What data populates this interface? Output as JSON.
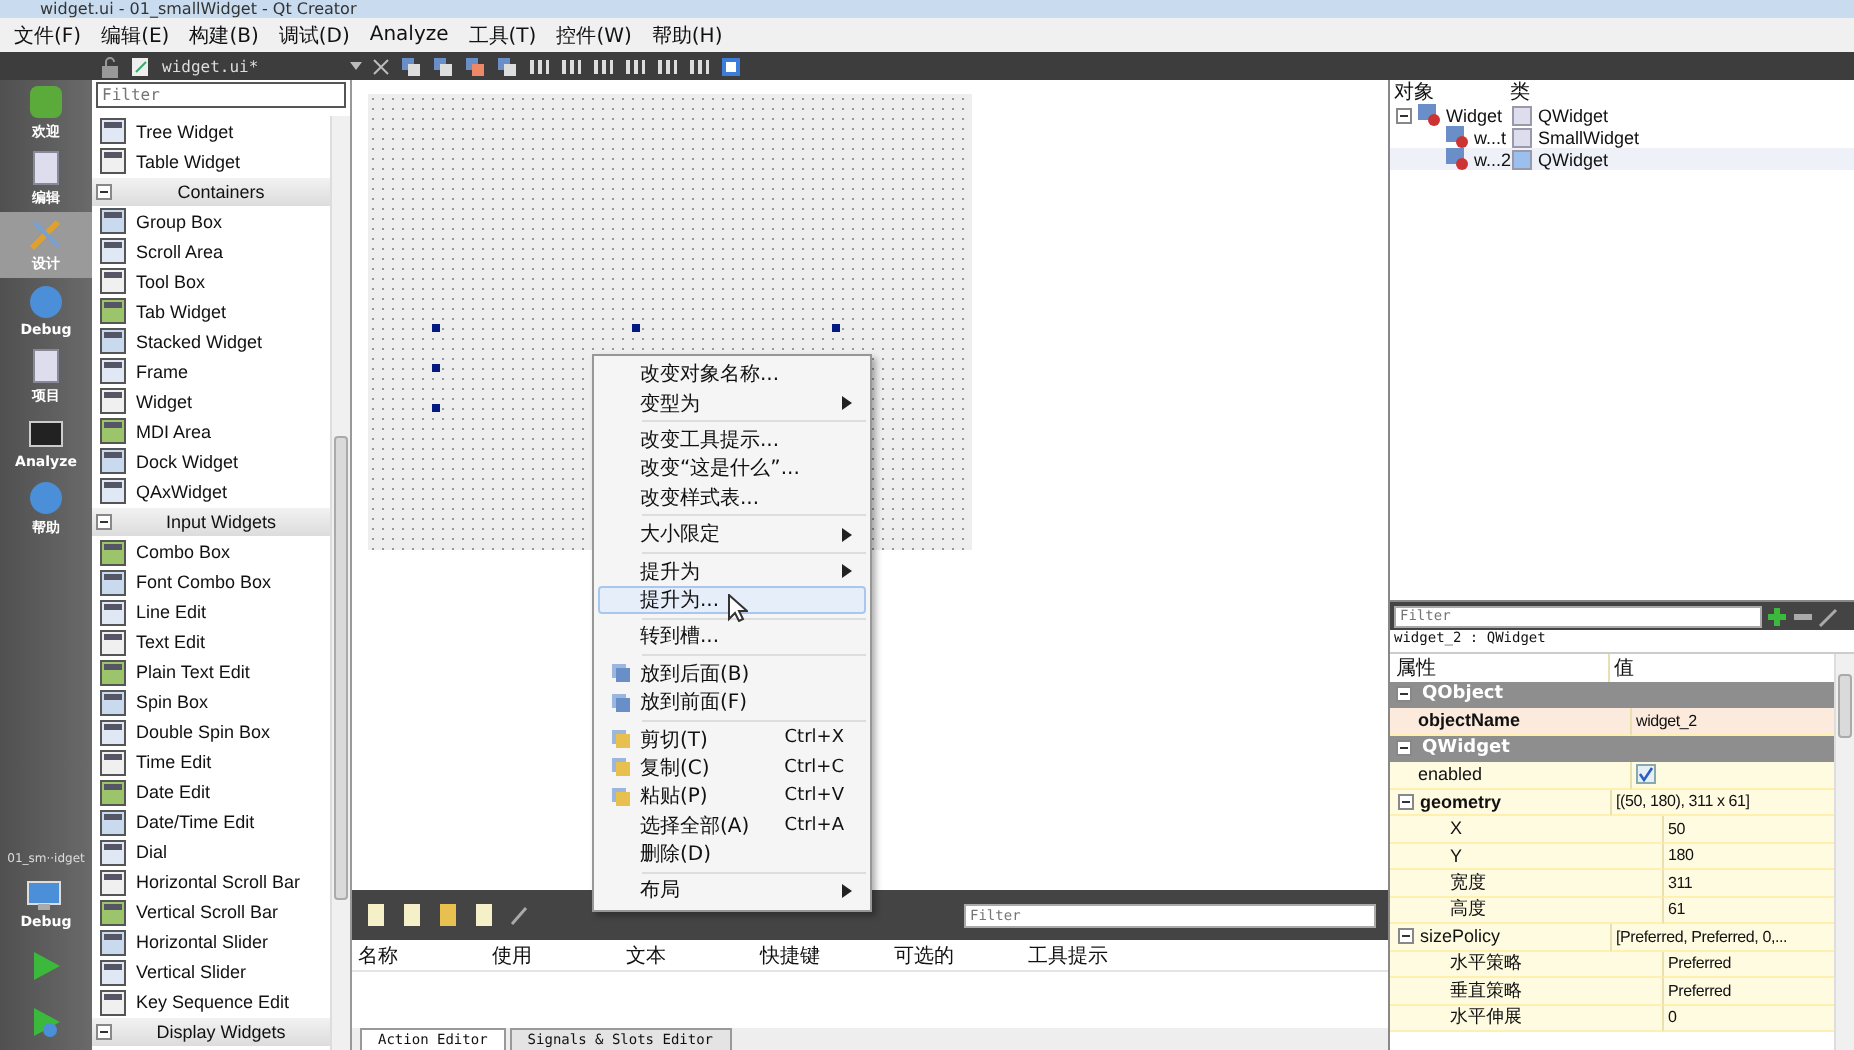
{
  "window": {
    "title": "widget.ui - 01_smallWidget - Qt Creator"
  },
  "menu_bar": [
    "文件(F)",
    "编辑(E)",
    "构建(B)",
    "调试(D)",
    "Analyze",
    "工具(T)",
    "控件(W)",
    "帮助(H)"
  ],
  "editor_toolbar": {
    "file": "widget.ui*"
  },
  "mode_bar": {
    "modes": [
      {
        "label": "欢迎",
        "selected": false
      },
      {
        "label": "编辑",
        "selected": false
      },
      {
        "label": "设计",
        "selected": true
      },
      {
        "label": "Debug",
        "selected": false
      },
      {
        "label": "项目",
        "selected": false
      },
      {
        "label": "Analyze",
        "selected": false
      },
      {
        "label": "帮助",
        "selected": false
      }
    ],
    "project": "01_sm··idget",
    "kit": "Debug"
  },
  "widget_box": {
    "filter_placeholder": "Filter",
    "items": [
      {
        "kind": "item",
        "label": "Tree Widget"
      },
      {
        "kind": "item",
        "label": "Table Widget"
      },
      {
        "kind": "category",
        "label": "Containers",
        "expanded": true
      },
      {
        "kind": "item",
        "label": "Group Box"
      },
      {
        "kind": "item",
        "label": "Scroll Area"
      },
      {
        "kind": "item",
        "label": "Tool Box"
      },
      {
        "kind": "item",
        "label": "Tab Widget"
      },
      {
        "kind": "item",
        "label": "Stacked Widget"
      },
      {
        "kind": "item",
        "label": "Frame"
      },
      {
        "kind": "item",
        "label": "Widget"
      },
      {
        "kind": "item",
        "label": "MDI Area"
      },
      {
        "kind": "item",
        "label": "Dock Widget"
      },
      {
        "kind": "item",
        "label": "QAxWidget"
      },
      {
        "kind": "category",
        "label": "Input Widgets",
        "expanded": true
      },
      {
        "kind": "item",
        "label": "Combo Box"
      },
      {
        "kind": "item",
        "label": "Font Combo Box"
      },
      {
        "kind": "item",
        "label": "Line Edit"
      },
      {
        "kind": "item",
        "label": "Text Edit"
      },
      {
        "kind": "item",
        "label": "Plain Text Edit"
      },
      {
        "kind": "item",
        "label": "Spin Box"
      },
      {
        "kind": "item",
        "label": "Double Spin Box"
      },
      {
        "kind": "item",
        "label": "Time Edit"
      },
      {
        "kind": "item",
        "label": "Date Edit"
      },
      {
        "kind": "item",
        "label": "Date/Time Edit"
      },
      {
        "kind": "item",
        "label": "Dial"
      },
      {
        "kind": "item",
        "label": "Horizontal Scroll Bar"
      },
      {
        "kind": "item",
        "label": "Vertical Scroll Bar"
      },
      {
        "kind": "item",
        "label": "Horizontal Slider"
      },
      {
        "kind": "item",
        "label": "Vertical Slider"
      },
      {
        "kind": "item",
        "label": "Key Sequence Edit"
      },
      {
        "kind": "category",
        "label": "Display Widgets",
        "expanded": true
      }
    ]
  },
  "context_menu": {
    "groups": [
      [
        {
          "label": "改变对象名称...",
          "submenu": false,
          "selected": false,
          "icon": false
        },
        {
          "label": "变型为",
          "submenu": true,
          "selected": false,
          "icon": false
        }
      ],
      [
        {
          "label": "改变工具提示...",
          "submenu": false,
          "selected": false,
          "icon": false
        },
        {
          "label": "改变“这是什么”...",
          "submenu": false,
          "selected": false,
          "icon": false
        },
        {
          "label": "改变样式表...",
          "submenu": false,
          "selected": false,
          "icon": false
        }
      ],
      [
        {
          "label": "大小限定",
          "submenu": true,
          "selected": false,
          "icon": false
        }
      ],
      [
        {
          "label": "提升为",
          "submenu": true,
          "selected": false,
          "icon": false
        },
        {
          "label": "提升为...",
          "submenu": false,
          "selected": true,
          "icon": false
        }
      ],
      [
        {
          "label": "转到槽...",
          "submenu": false,
          "selected": false,
          "icon": false
        }
      ],
      [
        {
          "label": "放到后面(B)",
          "submenu": false,
          "selected": false,
          "icon": true
        },
        {
          "label": "放到前面(F)",
          "submenu": false,
          "selected": false,
          "icon": true
        }
      ],
      [
        {
          "label": "剪切(T)",
          "shortcut": "Ctrl+X",
          "submenu": false,
          "selected": false,
          "icon": true
        },
        {
          "label": "复制(C)",
          "shortcut": "Ctrl+C",
          "submenu": false,
          "selected": false,
          "icon": true
        },
        {
          "label": "粘贴(P)",
          "shortcut": "Ctrl+V",
          "submenu": false,
          "selected": false,
          "icon": true
        },
        {
          "label": "选择全部(A)",
          "shortcut": "Ctrl+A",
          "submenu": false,
          "selected": false,
          "icon": false
        },
        {
          "label": "删除(D)",
          "submenu": false,
          "selected": false,
          "icon": false
        }
      ],
      [
        {
          "label": "布局",
          "submenu": true,
          "selected": false,
          "icon": false
        }
      ]
    ]
  },
  "object_inspector": {
    "columns": [
      "对象",
      "类"
    ],
    "tree": [
      {
        "object": "Widget",
        "class": "QWidget",
        "expanded": true,
        "selected": false,
        "children": [
          {
            "object": "w...t",
            "class": "SmallWidget",
            "selected": false
          },
          {
            "object": "w...2",
            "class": "QWidget",
            "selected": true
          }
        ]
      }
    ]
  },
  "property_editor": {
    "filter_placeholder": "Filter",
    "current": "widget_2 : QWidget",
    "columns": [
      "属性",
      "值"
    ],
    "rows": [
      {
        "kind": "group",
        "name": "QObject",
        "expanded": true
      },
      {
        "kind": "property",
        "name": "objectName",
        "value": "widget_2",
        "changed": true,
        "selected": true
      },
      {
        "kind": "group",
        "name": "QWidget",
        "expanded": true
      },
      {
        "kind": "checkbox",
        "name": "enabled",
        "checked": true,
        "changed": false,
        "selected": false
      },
      {
        "kind": "property",
        "name": "geometry",
        "value": "[(50, 180), 311 x 61]",
        "changed": true,
        "selected": false,
        "expanded": true,
        "children": [
          {
            "kind": "property",
            "name": "X",
            "value": "50",
            "changed": false,
            "selected": false
          },
          {
            "kind": "property",
            "name": "Y",
            "value": "180",
            "changed": false,
            "selected": false
          },
          {
            "kind": "property",
            "name": "宽度",
            "value": "311",
            "changed": false,
            "selected": false
          },
          {
            "kind": "property",
            "name": "高度",
            "value": "61",
            "changed": false,
            "selected": false
          }
        ]
      },
      {
        "kind": "property",
        "name": "sizePolicy",
        "value": "[Preferred, Preferred, 0,...",
        "changed": false,
        "selected": false,
        "expanded": true,
        "children": [
          {
            "kind": "property",
            "name": "水平策略",
            "value": "Preferred",
            "changed": false,
            "selected": false
          },
          {
            "kind": "property",
            "name": "垂直策略",
            "value": "Preferred",
            "changed": false,
            "selected": false
          },
          {
            "kind": "property",
            "name": "水平伸展",
            "value": "0",
            "changed": false,
            "selected": false
          }
        ]
      }
    ]
  },
  "action_editor": {
    "filter_placeholder": "Filter",
    "columns": [
      "名称",
      "使用",
      "文本",
      "快捷键",
      "可选的",
      "工具提示"
    ],
    "tabs": [
      {
        "label": "Action Editor",
        "selected": true
      },
      {
        "label": "Signals & Slots Editor",
        "selected": false
      }
    ]
  }
}
